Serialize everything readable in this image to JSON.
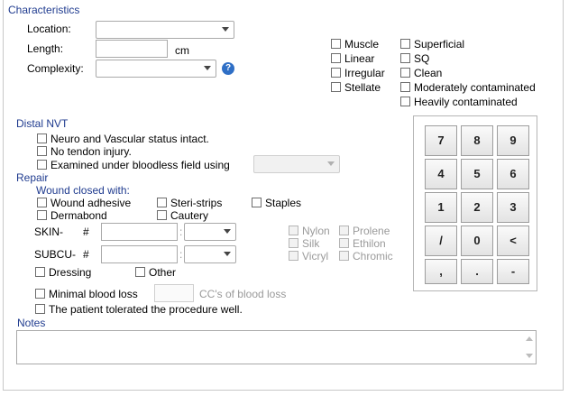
{
  "characteristics": {
    "title": "Characteristics",
    "location_label": "Location:",
    "length_label": "Length:",
    "length_unit": "cm",
    "complexity_label": "Complexity:",
    "help_glyph": "?",
    "wound_types": [
      "Muscle",
      "Linear",
      "Irregular",
      "Stellate"
    ],
    "contamination": [
      "Superficial",
      "SQ",
      "Clean",
      "Moderately contaminated",
      "Heavily contaminated"
    ]
  },
  "distal_nvt": {
    "title": "Distal NVT",
    "items": [
      "Neuro and Vascular status intact.",
      "No tendon injury.",
      "Examined under bloodless field using"
    ]
  },
  "repair": {
    "title": "Repair",
    "closed_with_label": "Wound closed with:",
    "closure_options": [
      "Wound adhesive",
      "Dermabond",
      "Steri-strips",
      "Cautery",
      "Staples"
    ],
    "skin_label": "SKIN-",
    "subcu_label": "SUBCU-",
    "hash": "#",
    "colon": ":",
    "suture_left": [
      "Nylon",
      "Silk",
      "Vicryl"
    ],
    "suture_right": [
      "Prolene",
      "Ethilon",
      "Chromic"
    ],
    "dressing_label": "Dressing",
    "other_label": "Other",
    "minimal_blood_loss_label": "Minimal blood loss",
    "blood_loss_unit": "CC's of blood loss",
    "tolerated_label": "The patient tolerated the procedure well."
  },
  "notes": {
    "title": "Notes",
    "value": ""
  },
  "keypad": {
    "keys": [
      "7",
      "8",
      "9",
      "4",
      "5",
      "6",
      "1",
      "2",
      "3",
      "/",
      "0",
      "<",
      ",",
      ".",
      "-"
    ]
  },
  "colors": {
    "section_blue": "#1f3b8f",
    "help_blue": "#2f6fc6",
    "disabled_text": "#9a9a9a"
  }
}
